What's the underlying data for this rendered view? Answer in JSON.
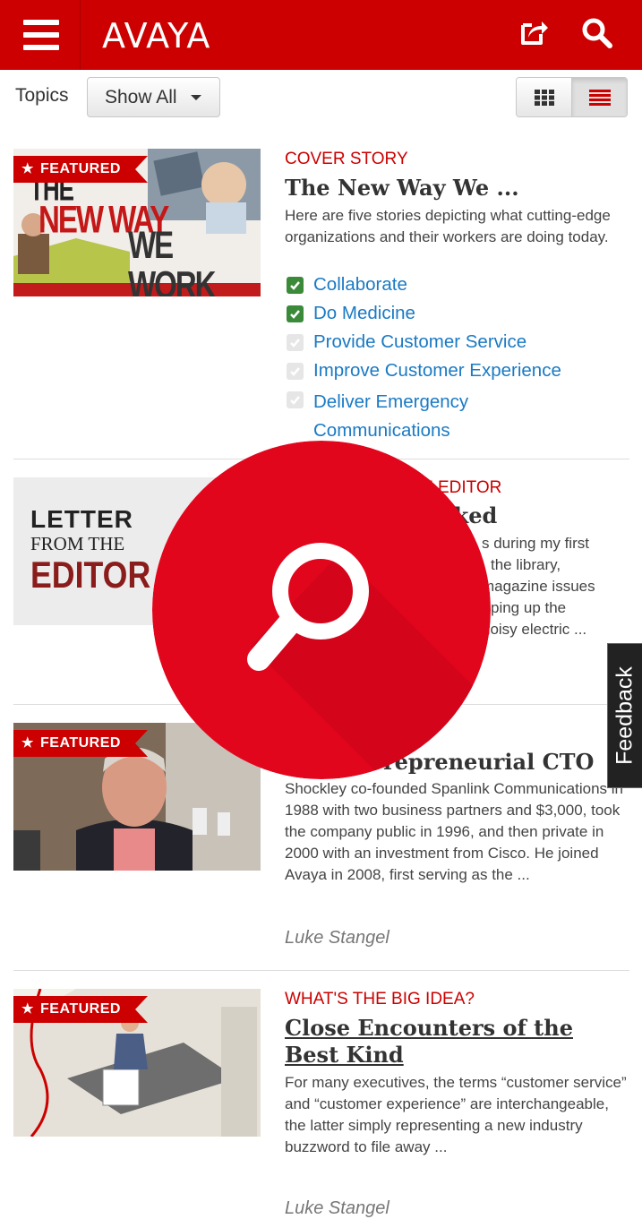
{
  "header": {
    "logo_text": "AVAYA",
    "bg_color": "#cc0000",
    "icons": [
      "menu-icon",
      "share-icon",
      "search-icon"
    ]
  },
  "toolbar": {
    "topics_label": "Topics",
    "filter_value": "Show All",
    "views": [
      "grid-view-icon",
      "list-view-icon"
    ],
    "active_view": "list"
  },
  "articles": [
    {
      "featured": true,
      "badge": "FEATURED",
      "thumb_text": [
        "THE",
        "NEW WAY",
        "WE WORK"
      ],
      "category": "COVER STORY",
      "title": "The New Way We ...",
      "excerpt": "Here are five stories depicting what cutting-edge organizations and their workers are doing today.",
      "topics": [
        {
          "label": "Collaborate",
          "checked": true
        },
        {
          "label": "Do Medicine",
          "checked": true
        },
        {
          "label": "Provide Customer Service",
          "checked": false
        },
        {
          "label": "Improve Customer Experience",
          "checked": false
        },
        {
          "label": "Deliver Emergency Communications",
          "checked": false
        }
      ]
    },
    {
      "featured": false,
      "thumb_text": [
        "LETTER",
        "FROM THE",
        "EDITOR"
      ],
      "category": "E EDITOR",
      "title": "orked",
      "excerpt_lines": [
        "s during my first",
        "the library,",
        "magazine issues",
        "ping up the",
        "noisy electric ..."
      ]
    },
    {
      "featured": true,
      "badge": "FEATURED",
      "title": "repreneurial CTO",
      "excerpt": "Shockley co-founded Spanlink Communications in 1988 with two business partners and $3,000, took the company public in 1996, and then private in 2000 with an investment from Cisco. He joined Avaya in 2008, first serving as the ...",
      "author": "Luke Stangel"
    },
    {
      "featured": true,
      "badge": "FEATURED",
      "category": "WHAT'S THE BIG IDEA?",
      "title": "Close Encounters of the Best Kind",
      "excerpt": "For many executives, the terms “customer service” and “customer experience” are interchangeable, the latter simply representing a new industry buzzword to file away ...",
      "author": "Luke Stangel"
    }
  ],
  "feedback_tab": "Feedback",
  "overlay": {
    "icon": "magnifier-icon",
    "color": "#e2061d"
  }
}
